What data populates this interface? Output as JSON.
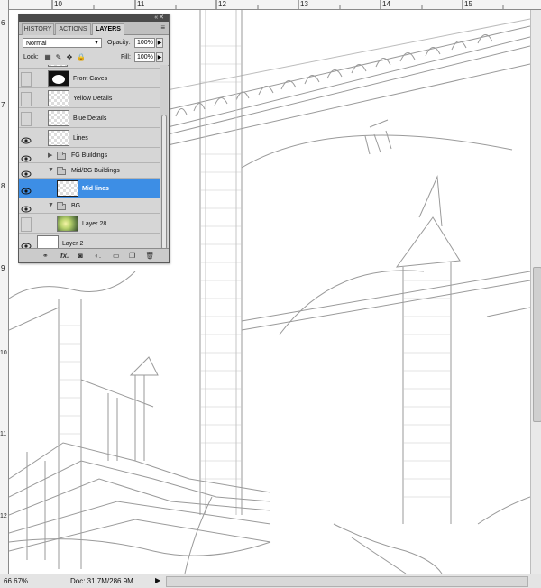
{
  "rulers": {
    "top_numbers": [
      "10",
      "11",
      "12",
      "13",
      "14",
      "15"
    ],
    "left_numbers": [
      "6",
      "7",
      "8",
      "9",
      "10",
      "11",
      "12"
    ]
  },
  "panel": {
    "tabs": [
      "HISTORY",
      "ACTIONS",
      "LAYERS"
    ],
    "blend_mode": "Normal",
    "opacity_label": "Opacity:",
    "opacity_value": "100%",
    "lock_label": "Lock:",
    "fill_label": "Fill:",
    "fill_value": "100%",
    "layers": [
      {
        "name": "Front Caves",
        "visible": false,
        "thumb": "black"
      },
      {
        "name": "Yellow Details",
        "visible": false,
        "thumb": "transparent"
      },
      {
        "name": "Blue Details",
        "visible": false,
        "thumb": "transparent"
      },
      {
        "name": "Lines",
        "visible": true,
        "thumb": "transparent"
      },
      {
        "name": "FG Buildings",
        "visible": true,
        "group": true,
        "expanded": false
      },
      {
        "name": "Mid/BG Buildings",
        "visible": true,
        "group": true,
        "expanded": true
      },
      {
        "name": "Mid lines",
        "visible": true,
        "thumb": "transparent",
        "selected": true
      },
      {
        "name": "BG",
        "visible": true,
        "group": true,
        "expanded": true
      },
      {
        "name": "Layer 28",
        "visible": false,
        "thumb": "photo"
      },
      {
        "name": "Layer 2",
        "visible": true,
        "thumb": "white"
      }
    ],
    "footer_icons": [
      "link-icon",
      "fx-icon",
      "mask-icon",
      "adjustment-icon",
      "group-icon",
      "new-layer-icon",
      "trash-icon"
    ]
  },
  "statusbar": {
    "zoom": "66.67%",
    "doc": "Doc: 31.7M/286.9M"
  },
  "colors": {
    "selection": "#3d8ee5",
    "panel_bg": "#d6d6d6"
  }
}
